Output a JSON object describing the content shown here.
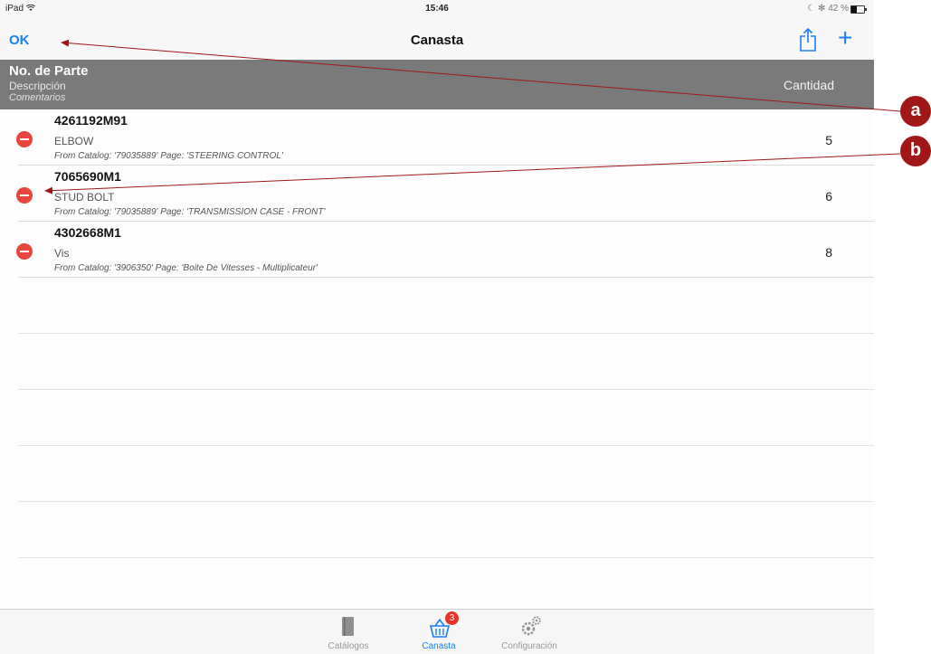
{
  "status_bar": {
    "device": "iPad",
    "time": "15:46",
    "battery": "42 %",
    "battery_level": 0.42
  },
  "nav": {
    "left_button": "OK",
    "title": "Canasta",
    "icons": [
      "share-icon",
      "plus-icon"
    ]
  },
  "table_header": {
    "part_label": "No. de Parte",
    "desc_label": "Descripción",
    "comment_label": "Comentarios",
    "qty_label": "Cantidad"
  },
  "items": [
    {
      "part": "4261192M91",
      "desc": "ELBOW",
      "comment": "From Catalog: '79035889' Page: 'STEERING CONTROL'",
      "qty": "5"
    },
    {
      "part": "7065690M1",
      "desc": "STUD BOLT",
      "comment": "From Catalog: '79035889' Page: 'TRANSMISSION CASE - FRONT'",
      "qty": "6"
    },
    {
      "part": "4302668M1",
      "desc": "Vis",
      "comment": "From Catalog: '3906350' Page: 'Boite De Vitesses - Multiplicateur'",
      "qty": "8"
    }
  ],
  "tabs": [
    {
      "label": "Catálogos",
      "icon": "book-icon",
      "active": false
    },
    {
      "label": "Canasta",
      "icon": "basket-icon",
      "active": true,
      "badge": "3"
    },
    {
      "label": "Configuración",
      "icon": "gears-icon",
      "active": false
    }
  ],
  "annotations": {
    "a": "a",
    "b": "b"
  },
  "colors": {
    "accent": "#1a7ff0",
    "delete": "#e8463c",
    "header": "#7a7a7a",
    "callout": "#a11616"
  }
}
